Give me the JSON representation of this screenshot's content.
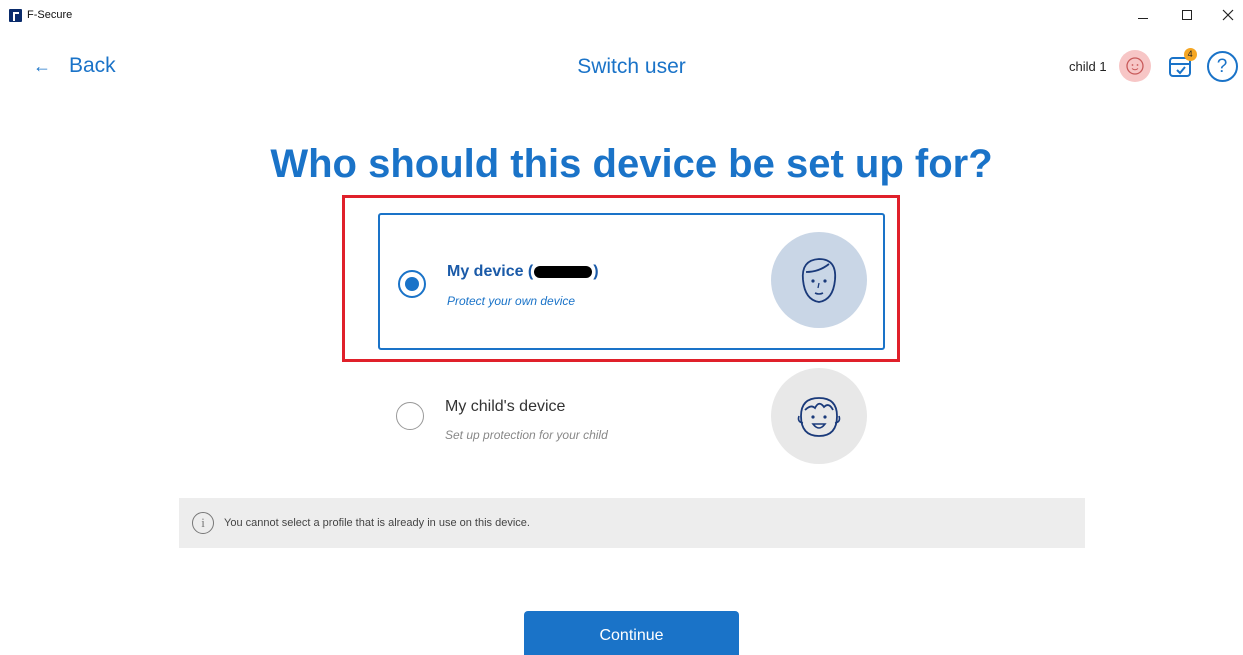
{
  "window": {
    "app_name": "F-Secure",
    "minimize_glyph": "–",
    "close_glyph": "✕"
  },
  "header": {
    "back_label": "Back",
    "back_arrow": "←",
    "title": "Switch user",
    "user_name": "child 1",
    "notification_count": "4",
    "help_glyph": "?"
  },
  "main": {
    "heading": "Who should this device be set up for?",
    "options": [
      {
        "title_prefix": "My device (",
        "title_suffix": ")",
        "subtitle": "Protect your own device",
        "selected": true,
        "icon": "adult-face-icon"
      },
      {
        "title": "My child's device",
        "subtitle": "Set up protection for your child",
        "selected": false,
        "icon": "child-face-icon"
      }
    ],
    "info_glyph": "i",
    "info_text": "You cannot select a profile that is already in use on this device.",
    "continue_label": "Continue"
  },
  "colors": {
    "accent": "#1a73c8",
    "highlight": "#e0202a",
    "badge": "#f5a623"
  }
}
